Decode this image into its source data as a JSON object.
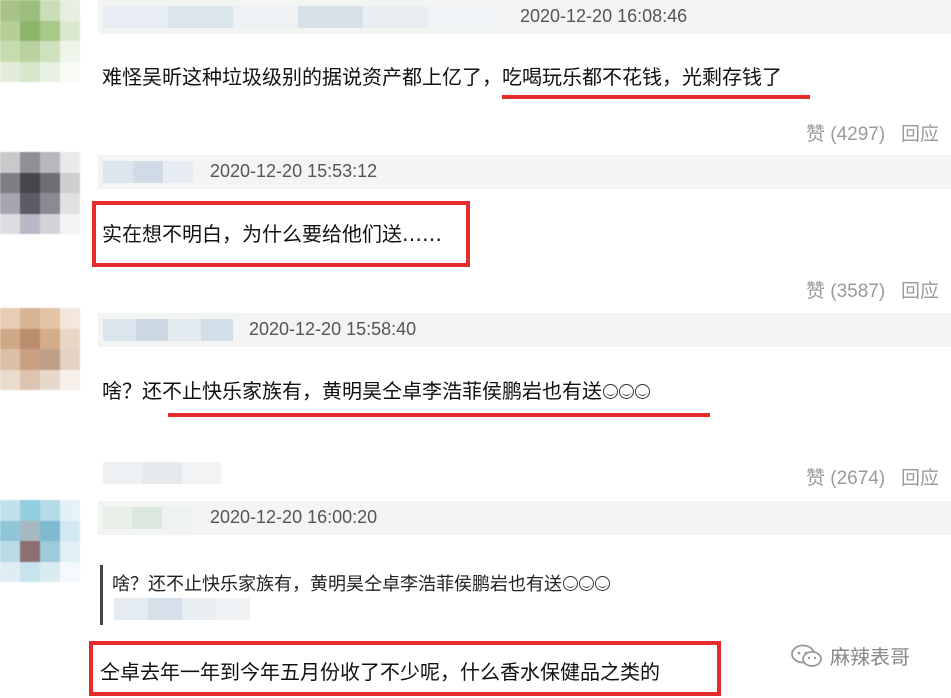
{
  "comments": [
    {
      "timestamp": "2020-12-20 16:08:46",
      "text": "难怪吴昕这种垃圾级别的据说资产都上亿了，吃喝玩乐都不花钱，光剩存钱了",
      "likes": "赞 (4297)",
      "reply": "回应"
    },
    {
      "timestamp": "2020-12-20 15:53:12",
      "text": "实在想不明白，为什么要给他们送……",
      "likes": "赞 (3587)",
      "reply": "回应"
    },
    {
      "timestamp": "2020-12-20 15:58:40",
      "text": "啥？还不止快乐家族有，黄明昊仝卓李浩菲侯鹏岩也有送",
      "emoji_count": 3,
      "likes": "赞 (2674)",
      "reply": "回应"
    },
    {
      "timestamp": "2020-12-20 16:00:20",
      "quote": "啥？还不止快乐家族有，黄明昊仝卓李浩菲侯鹏岩也有送",
      "text": "仝卓去年一年到今年五月份收了不少呢，什么香水保健品之类的"
    }
  ],
  "icons": {
    "emoji": "grinning-face-icon",
    "watermark": "wechat-icon"
  },
  "watermark": {
    "text": "麻辣表哥"
  },
  "colors": {
    "highlight": "#e52c2c",
    "meta_background": "#f3f5f3",
    "secondary_text": "#9a9a9a"
  }
}
